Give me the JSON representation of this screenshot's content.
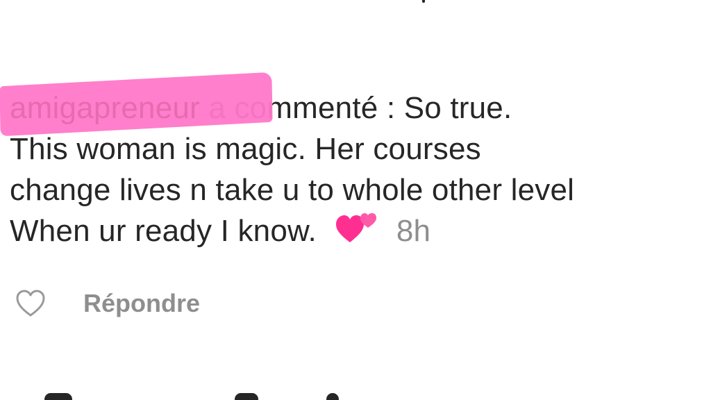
{
  "comment": {
    "username": "amigapreneur",
    "verb": " a commenté : So true.",
    "lines": [
      "This woman is magic. Her courses",
      "change lives n take u to whole other level",
      "When ur ready I know."
    ],
    "emoji": "two-hearts-emoji",
    "timestamp": "8h"
  },
  "actions": {
    "like_icon": "heart-outline-icon",
    "reply_label": "Répondre"
  },
  "colors": {
    "text": "#262626",
    "muted": "#8e8e8e",
    "highlight": "#ff78c9",
    "heart": "#ff2f92"
  }
}
